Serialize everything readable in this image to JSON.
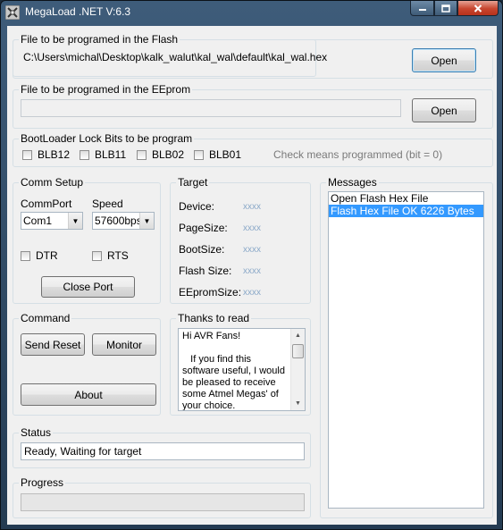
{
  "window": {
    "title": "MegaLoad .NET V:6.3",
    "icon": "app-icon"
  },
  "flash": {
    "legend": "File to be programed in the Flash",
    "path": "C:\\Users\\michal\\Desktop\\kalk_walut\\kal_wal\\default\\kal_wal.hex",
    "open_label": "Open"
  },
  "eeprom": {
    "legend": "File to be programed in the EEprom",
    "path": "",
    "open_label": "Open"
  },
  "lockbits": {
    "legend": "BootLoader Lock Bits to be program",
    "bits": [
      "BLB12",
      "BLB11",
      "BLB02",
      "BLB01"
    ],
    "note": "Check means programmed (bit = 0)"
  },
  "comm": {
    "legend": "Comm Setup",
    "port_label": "CommPort",
    "speed_label": "Speed",
    "port_value": "Com1",
    "speed_value": "57600bps",
    "dtr_label": "DTR",
    "rts_label": "RTS",
    "close_port_label": "Close Port"
  },
  "target": {
    "legend": "Target",
    "rows": [
      {
        "label": "Device:",
        "value": "xxxx"
      },
      {
        "label": "PageSize:",
        "value": "xxxx"
      },
      {
        "label": "BootSize:",
        "value": "xxxx"
      },
      {
        "label": "Flash Size:",
        "value": "xxxx"
      },
      {
        "label": "EEpromSize:",
        "value": "xxxx"
      }
    ]
  },
  "messages": {
    "legend": "Messages",
    "items": [
      "Open Flash Hex File",
      "Flash Hex File OK 6226 Bytes"
    ],
    "selected_index": 1
  },
  "command": {
    "legend": "Command",
    "send_reset_label": "Send Reset",
    "monitor_label": "Monitor",
    "about_label": "About"
  },
  "thanks": {
    "legend": "Thanks to read",
    "text": "Hi AVR Fans!\n\n   If you find this software useful, I would be pleased to receive some Atmel Megas' of your choice."
  },
  "status": {
    "legend": "Status",
    "text": "Ready, Waiting for target"
  },
  "progress": {
    "legend": "Progress",
    "value": 0
  },
  "colors": {
    "selection": "#3399ff",
    "title_bar": "#3e5c7a",
    "close_button": "#c7452e",
    "target_value": "#8aa8c8"
  }
}
